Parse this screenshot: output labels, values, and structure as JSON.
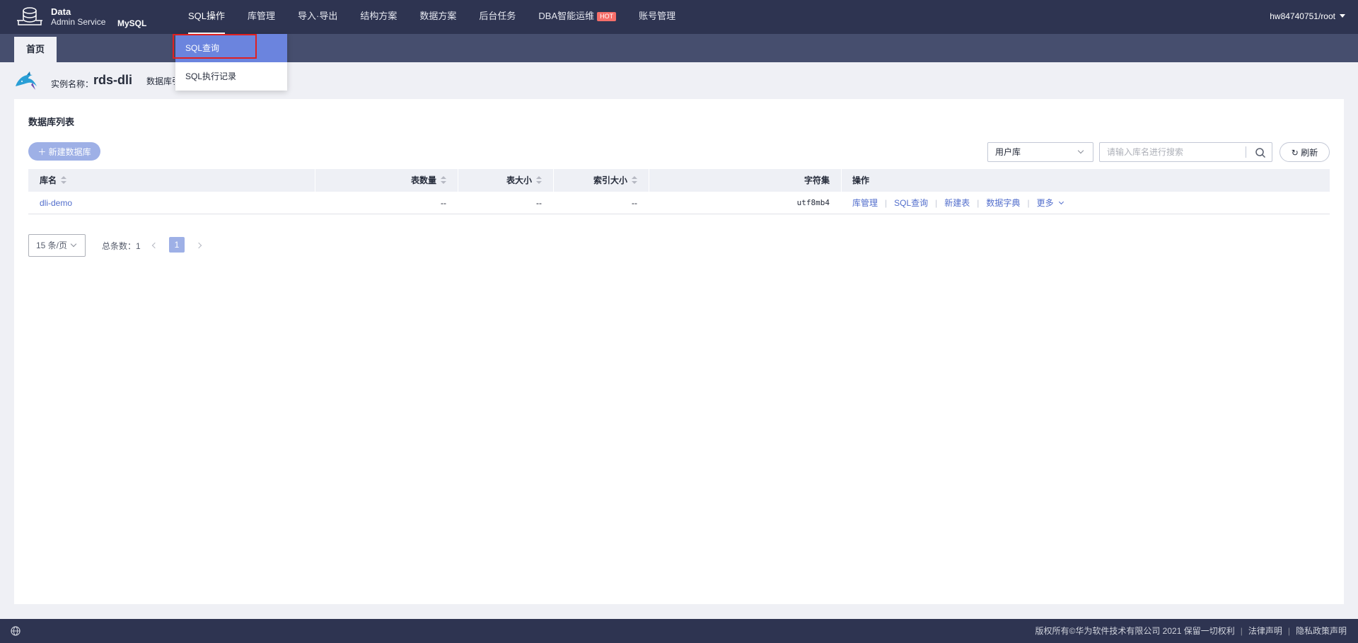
{
  "brand": {
    "line1": "Data",
    "line2": "Admin Service",
    "db": "MySQL"
  },
  "nav": {
    "items": [
      {
        "label": "SQL操作"
      },
      {
        "label": "库管理"
      },
      {
        "label": "导入·导出"
      },
      {
        "label": "结构方案"
      },
      {
        "label": "数据方案"
      },
      {
        "label": "后台任务"
      },
      {
        "label": "DBA智能运维",
        "badge": "HOT"
      },
      {
        "label": "账号管理"
      }
    ],
    "user": "hw84740751/root"
  },
  "dropdown": {
    "items": [
      "SQL查询",
      "SQL执行记录"
    ]
  },
  "tabs": {
    "home": "首页"
  },
  "instance": {
    "label": "实例名称：",
    "name": "rds-dli",
    "engine_label": "数据库引擎"
  },
  "main": {
    "title": "数据库列表",
    "new_button": "新建数据库",
    "filter_value": "用户库",
    "search_placeholder": "请输入库名进行搜索",
    "refresh_label": "刷新"
  },
  "table": {
    "headers": [
      "库名",
      "表数量",
      "表大小",
      "索引大小",
      "字符集",
      "操作"
    ],
    "rows": [
      {
        "name": "dli-demo",
        "tables": "--",
        "size": "--",
        "index_size": "--",
        "charset": "utf8mb4"
      }
    ],
    "ops": [
      "库管理",
      "SQL查询",
      "新建表",
      "数据字典",
      "更多"
    ]
  },
  "pagination": {
    "page_size": "15 条/页",
    "total": "总条数：1",
    "current": "1"
  },
  "footer": {
    "copyright": "版权所有©华为软件技术有限公司 2021 保留一切权利",
    "legal": "法律声明",
    "privacy": "隐私政策声明"
  },
  "colors": {
    "nav_bg": "#2e3451",
    "tab_bg": "#464e6e",
    "accent": "#526ecc",
    "primary_btn": "#9eb0e6",
    "hot": "#f66f6a",
    "highlight": "#e02020"
  }
}
